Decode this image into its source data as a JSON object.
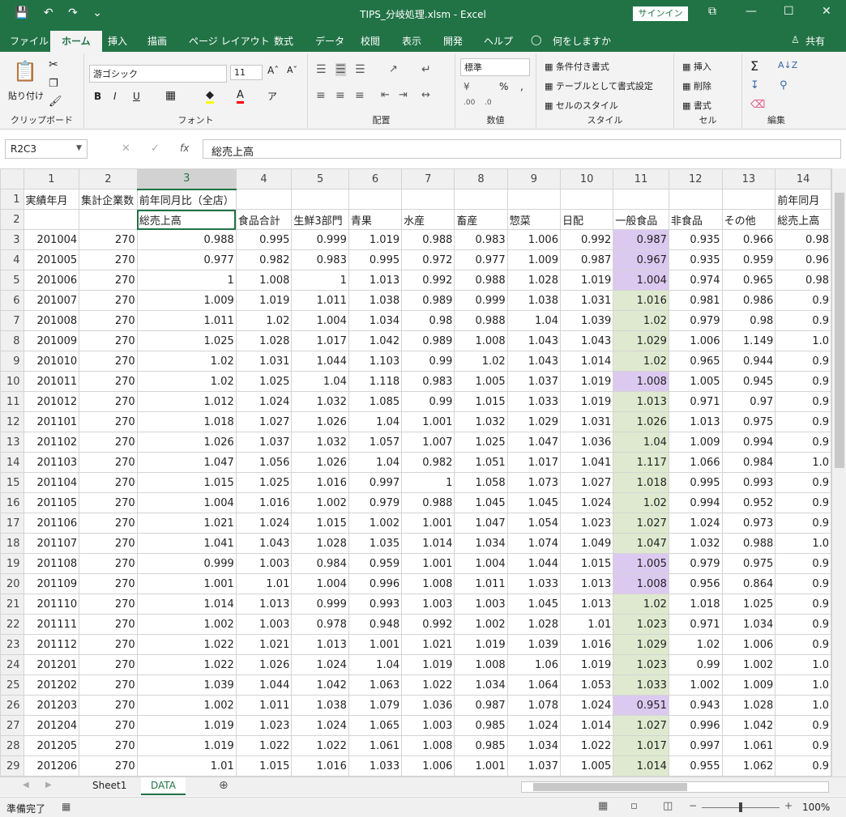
{
  "window": {
    "title": "TIPS_分岐処理.xlsm  -  Excel",
    "signin": "サインイン",
    "save_icon": "💾",
    "undo_icon": "↶",
    "redo_icon": "↷",
    "qat_more": "⌄",
    "restore_icon": "⧉",
    "minimize_icon": "—",
    "maximize_icon": "☐",
    "close_icon": "✕"
  },
  "tabs": [
    "ファイル",
    "ホーム",
    "挿入",
    "描画",
    "ページ レイアウト",
    "数式",
    "データ",
    "校閲",
    "表示",
    "開発",
    "ヘルプ"
  ],
  "tell_me": "何をしますか",
  "share": "共有",
  "ribbon": {
    "clipboard": {
      "label": "クリップボード",
      "paste": "貼り付け"
    },
    "font": {
      "label": "フォント",
      "name": "游ゴシック",
      "size": "11",
      "bold": "B",
      "italic": "I",
      "underline": "U"
    },
    "align": {
      "label": "配置"
    },
    "number": {
      "label": "数値",
      "format": "標準",
      "percent": "%"
    },
    "style": {
      "label": "スタイル",
      "cond": "条件付き書式",
      "table": "テーブルとして書式設定",
      "cell": "セルのスタイル"
    },
    "cells": {
      "label": "セル",
      "insert": "挿入",
      "delete": "削除",
      "format": "書式"
    },
    "edit": {
      "label": "編集",
      "sum": "Σ"
    }
  },
  "formula_bar": {
    "name_box": "R2C3",
    "fx": "fx",
    "value": "総売上高"
  },
  "grid": {
    "col_headers": [
      "1",
      "2",
      "3",
      "4",
      "5",
      "6",
      "7",
      "8",
      "9",
      "10",
      "11",
      "12",
      "13",
      "14"
    ],
    "row1": [
      "実績年月",
      "集計企業数",
      "前年同月比（全店）",
      "",
      "",
      "",
      "",
      "",
      "",
      "",
      "",
      "",
      "",
      "前年同月"
    ],
    "row2": [
      "",
      "",
      "総売上高",
      "食品合計",
      "生鮮3部門",
      "青果",
      "水産",
      "畜産",
      "惣菜",
      "日配",
      "一般食品",
      "非食品",
      "その他",
      "総売上高"
    ],
    "rows": [
      [
        "201004",
        "270",
        "0.988",
        "0.995",
        "0.999",
        "1.019",
        "0.988",
        "0.983",
        "1.006",
        "0.992",
        "0.987",
        "0.935",
        "0.966",
        "0.98"
      ],
      [
        "201005",
        "270",
        "0.977",
        "0.982",
        "0.983",
        "0.995",
        "0.972",
        "0.977",
        "1.009",
        "0.987",
        "0.967",
        "0.935",
        "0.959",
        "0.96"
      ],
      [
        "201006",
        "270",
        "1",
        "1.008",
        "1",
        "1.013",
        "0.992",
        "0.988",
        "1.028",
        "1.019",
        "1.004",
        "0.974",
        "0.965",
        "0.98"
      ],
      [
        "201007",
        "270",
        "1.009",
        "1.019",
        "1.011",
        "1.038",
        "0.989",
        "0.999",
        "1.038",
        "1.031",
        "1.016",
        "0.981",
        "0.986",
        "0.9"
      ],
      [
        "201008",
        "270",
        "1.011",
        "1.02",
        "1.004",
        "1.034",
        "0.98",
        "0.988",
        "1.04",
        "1.039",
        "1.02",
        "0.979",
        "0.98",
        "0.9"
      ],
      [
        "201009",
        "270",
        "1.025",
        "1.028",
        "1.017",
        "1.042",
        "0.989",
        "1.008",
        "1.043",
        "1.043",
        "1.029",
        "1.006",
        "1.149",
        "1.0"
      ],
      [
        "201010",
        "270",
        "1.02",
        "1.031",
        "1.044",
        "1.103",
        "0.99",
        "1.02",
        "1.043",
        "1.014",
        "1.02",
        "0.965",
        "0.944",
        "0.9"
      ],
      [
        "201011",
        "270",
        "1.02",
        "1.025",
        "1.04",
        "1.118",
        "0.983",
        "1.005",
        "1.037",
        "1.019",
        "1.008",
        "1.005",
        "0.945",
        "0.9"
      ],
      [
        "201012",
        "270",
        "1.012",
        "1.024",
        "1.032",
        "1.085",
        "0.99",
        "1.015",
        "1.033",
        "1.019",
        "1.013",
        "0.971",
        "0.97",
        "0.9"
      ],
      [
        "201101",
        "270",
        "1.018",
        "1.027",
        "1.026",
        "1.04",
        "1.001",
        "1.032",
        "1.029",
        "1.031",
        "1.026",
        "1.013",
        "0.975",
        "0.9"
      ],
      [
        "201102",
        "270",
        "1.026",
        "1.037",
        "1.032",
        "1.057",
        "1.007",
        "1.025",
        "1.047",
        "1.036",
        "1.04",
        "1.009",
        "0.994",
        "0.9"
      ],
      [
        "201103",
        "270",
        "1.047",
        "1.056",
        "1.026",
        "1.04",
        "0.982",
        "1.051",
        "1.017",
        "1.041",
        "1.117",
        "1.066",
        "0.984",
        "1.0"
      ],
      [
        "201104",
        "270",
        "1.015",
        "1.025",
        "1.016",
        "0.997",
        "1",
        "1.058",
        "1.073",
        "1.027",
        "1.018",
        "0.995",
        "0.993",
        "0.9"
      ],
      [
        "201105",
        "270",
        "1.004",
        "1.016",
        "1.002",
        "0.979",
        "0.988",
        "1.045",
        "1.045",
        "1.024",
        "1.02",
        "0.994",
        "0.952",
        "0.9"
      ],
      [
        "201106",
        "270",
        "1.021",
        "1.024",
        "1.015",
        "1.002",
        "1.001",
        "1.047",
        "1.054",
        "1.023",
        "1.027",
        "1.024",
        "0.973",
        "0.9"
      ],
      [
        "201107",
        "270",
        "1.041",
        "1.043",
        "1.028",
        "1.035",
        "1.014",
        "1.034",
        "1.074",
        "1.049",
        "1.047",
        "1.032",
        "0.988",
        "1.0"
      ],
      [
        "201108",
        "270",
        "0.999",
        "1.003",
        "0.984",
        "0.959",
        "1.001",
        "1.004",
        "1.044",
        "1.015",
        "1.005",
        "0.979",
        "0.975",
        "0.9"
      ],
      [
        "201109",
        "270",
        "1.001",
        "1.01",
        "1.004",
        "0.996",
        "1.008",
        "1.011",
        "1.033",
        "1.013",
        "1.008",
        "0.956",
        "0.864",
        "0.9"
      ],
      [
        "201110",
        "270",
        "1.014",
        "1.013",
        "0.999",
        "0.993",
        "1.003",
        "1.003",
        "1.045",
        "1.013",
        "1.02",
        "1.018",
        "1.025",
        "0.9"
      ],
      [
        "201111",
        "270",
        "1.002",
        "1.003",
        "0.978",
        "0.948",
        "0.992",
        "1.002",
        "1.028",
        "1.01",
        "1.023",
        "0.971",
        "1.034",
        "0.9"
      ],
      [
        "201112",
        "270",
        "1.022",
        "1.021",
        "1.013",
        "1.001",
        "1.021",
        "1.019",
        "1.039",
        "1.016",
        "1.029",
        "1.02",
        "1.006",
        "0.9"
      ],
      [
        "201201",
        "270",
        "1.022",
        "1.026",
        "1.024",
        "1.04",
        "1.019",
        "1.008",
        "1.06",
        "1.019",
        "1.023",
        "0.99",
        "1.002",
        "1.0"
      ],
      [
        "201202",
        "270",
        "1.039",
        "1.044",
        "1.042",
        "1.063",
        "1.022",
        "1.034",
        "1.064",
        "1.053",
        "1.033",
        "1.002",
        "1.009",
        "1.0"
      ],
      [
        "201203",
        "270",
        "1.002",
        "1.011",
        "1.038",
        "1.079",
        "1.036",
        "0.987",
        "1.078",
        "1.024",
        "0.951",
        "0.943",
        "1.028",
        "1.0"
      ],
      [
        "201204",
        "270",
        "1.019",
        "1.023",
        "1.024",
        "1.065",
        "1.003",
        "0.985",
        "1.024",
        "1.014",
        "1.027",
        "0.996",
        "1.042",
        "0.9"
      ],
      [
        "201205",
        "270",
        "1.019",
        "1.022",
        "1.022",
        "1.061",
        "1.008",
        "0.985",
        "1.034",
        "1.022",
        "1.017",
        "0.997",
        "1.061",
        "0.9"
      ],
      [
        "201206",
        "270",
        "1.01",
        "1.015",
        "1.016",
        "1.033",
        "1.006",
        "1.001",
        "1.037",
        "1.005",
        "1.014",
        "0.955",
        "1.062",
        "0.9"
      ]
    ],
    "col11_colors": [
      "purple",
      "purple",
      "purple",
      "green",
      "green",
      "green",
      "green",
      "purple",
      "green",
      "green",
      "green",
      "green",
      "green",
      "green",
      "green",
      "green",
      "purple",
      "purple",
      "green",
      "green",
      "green",
      "green",
      "green",
      "purple",
      "green",
      "green",
      "green"
    ]
  },
  "sheets": [
    "Sheet1",
    "DATA"
  ],
  "status": {
    "ready": "準備完了",
    "zoom": "100%"
  }
}
